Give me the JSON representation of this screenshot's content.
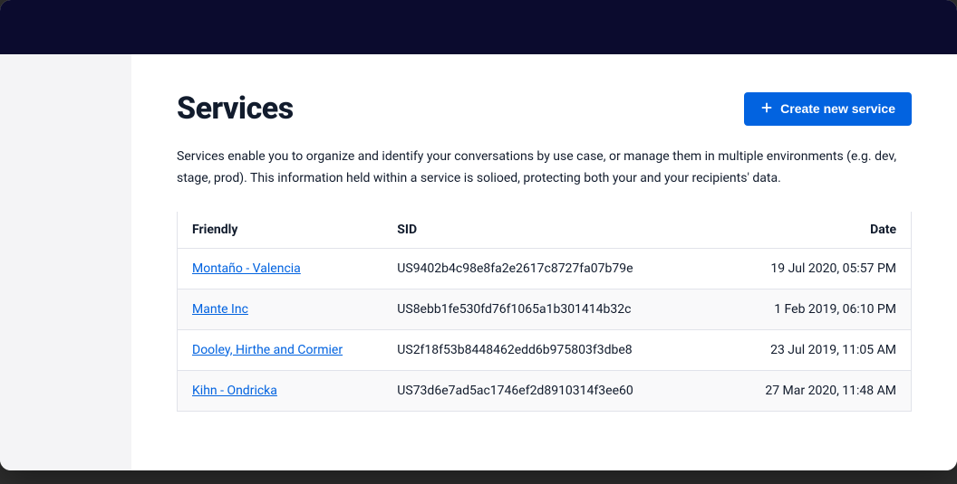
{
  "page": {
    "title": "Services",
    "description": "Services enable you to organize and identify your conversations by use case, or manage them in multiple environments (e.g. dev, stage, prod). This information held within a service is solioed, protecting both your and your recipients' data.",
    "createButtonLabel": "Create new service"
  },
  "table": {
    "headers": {
      "friendly": "Friendly",
      "sid": "SID",
      "date": "Date"
    },
    "rows": [
      {
        "friendly": "Montaño - Valencia",
        "sid": "US9402b4c98e8fa2e2617c8727fa07b79e",
        "date": "19 Jul 2020, 05:57 PM"
      },
      {
        "friendly": "Mante Inc",
        "sid": "US8ebb1fe530fd76f1065a1b301414b32c",
        "date": "1 Feb 2019, 06:10 PM"
      },
      {
        "friendly": "Dooley, Hirthe and Cormier",
        "sid": "US2f18f53b8448462edd6b975803f3dbe8",
        "date": "23 Jul 2019, 11:05 AM"
      },
      {
        "friendly": "Kihn - Ondricka",
        "sid": "US73d6e7ad5ac1746ef2d8910314f3ee60",
        "date": "27 Mar 2020, 11:48 AM"
      }
    ]
  }
}
